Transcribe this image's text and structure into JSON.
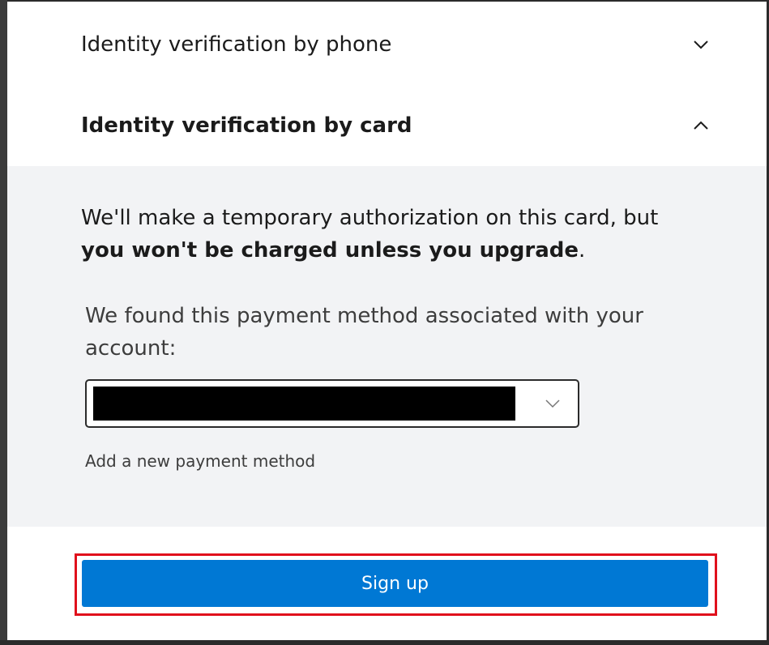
{
  "accordion": {
    "phone_label": "Identity verification by phone",
    "card_label": "Identity verification by card"
  },
  "card_panel": {
    "intro_normal": "We'll make a temporary authorization on this card, but ",
    "intro_bold": "you won't be charged unless you upgrade",
    "intro_end": ".",
    "found_text": "We found this payment method associated with your account:",
    "selected_value": "",
    "add_payment_link": "Add a new payment method"
  },
  "signup_button_label": "Sign up",
  "icons": {
    "phone_chevron": "chevron-down-icon",
    "card_chevron": "chevron-up-icon",
    "select_chevron": "chevron-down-icon"
  },
  "colors": {
    "primary": "#0078d4",
    "panel_background": "#f2f3f5",
    "highlight_border": "#e0101c",
    "text": "#1b1b1b"
  }
}
